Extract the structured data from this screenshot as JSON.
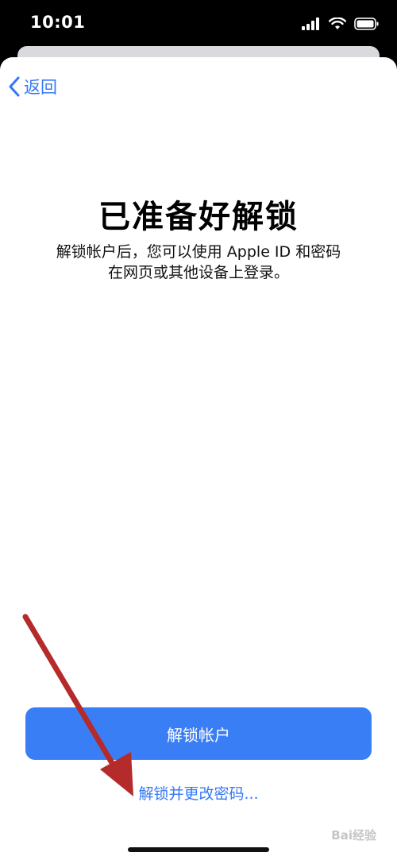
{
  "status_bar": {
    "time": "10:01",
    "icons": [
      "cellular-signal-icon",
      "wifi-icon",
      "battery-icon"
    ]
  },
  "nav": {
    "back_label": "返回",
    "back_icon": "chevron-left-icon"
  },
  "content": {
    "title": "已准备好解锁",
    "subtitle_line1": "解锁帐户后，您可以使用 Apple ID 和密码",
    "subtitle_line2": "在网页或其他设备上登录。"
  },
  "actions": {
    "primary_label": "解锁帐户",
    "secondary_label": "解锁并更改密码..."
  },
  "watermark": {
    "text": "Bai经验"
  },
  "colors": {
    "accent": "#3478f6",
    "button": "#3a7ef6",
    "annotation_arrow": "#b52a2a"
  }
}
